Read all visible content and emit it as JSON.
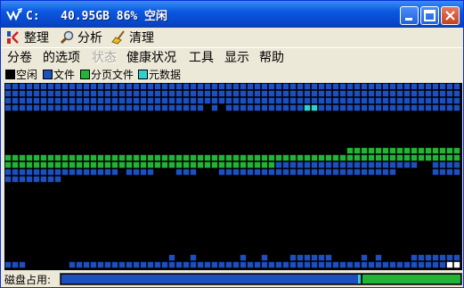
{
  "window": {
    "title": "C:   40.95GB 86% 空闲"
  },
  "toolbar": {
    "defrag_label": "整理",
    "analyze_label": "分析",
    "clean_label": "清理"
  },
  "menu": {
    "items": [
      {
        "label": "分卷",
        "enabled": true
      },
      {
        "label": "的选项",
        "enabled": true
      },
      {
        "label": "状态",
        "enabled": false
      },
      {
        "label": "健康状况",
        "enabled": true
      },
      {
        "label": "工具",
        "enabled": true
      },
      {
        "label": "显示",
        "enabled": true
      },
      {
        "label": "帮助",
        "enabled": true
      }
    ]
  },
  "legend": {
    "items": [
      {
        "label": "空闲",
        "color": "#000000"
      },
      {
        "label": "文件",
        "color": "#1c4fbf"
      },
      {
        "label": "分页文件",
        "color": "#22b436"
      },
      {
        "label": "元数据",
        "color": "#2fd0d0"
      }
    ]
  },
  "colors": {
    "free": "#000000",
    "file": "#1c4fbf",
    "pagefile": "#22b436",
    "metadata": "#2fd0d0"
  },
  "status": {
    "label": "磁盘占用:",
    "used_fraction": 0.75
  }
}
